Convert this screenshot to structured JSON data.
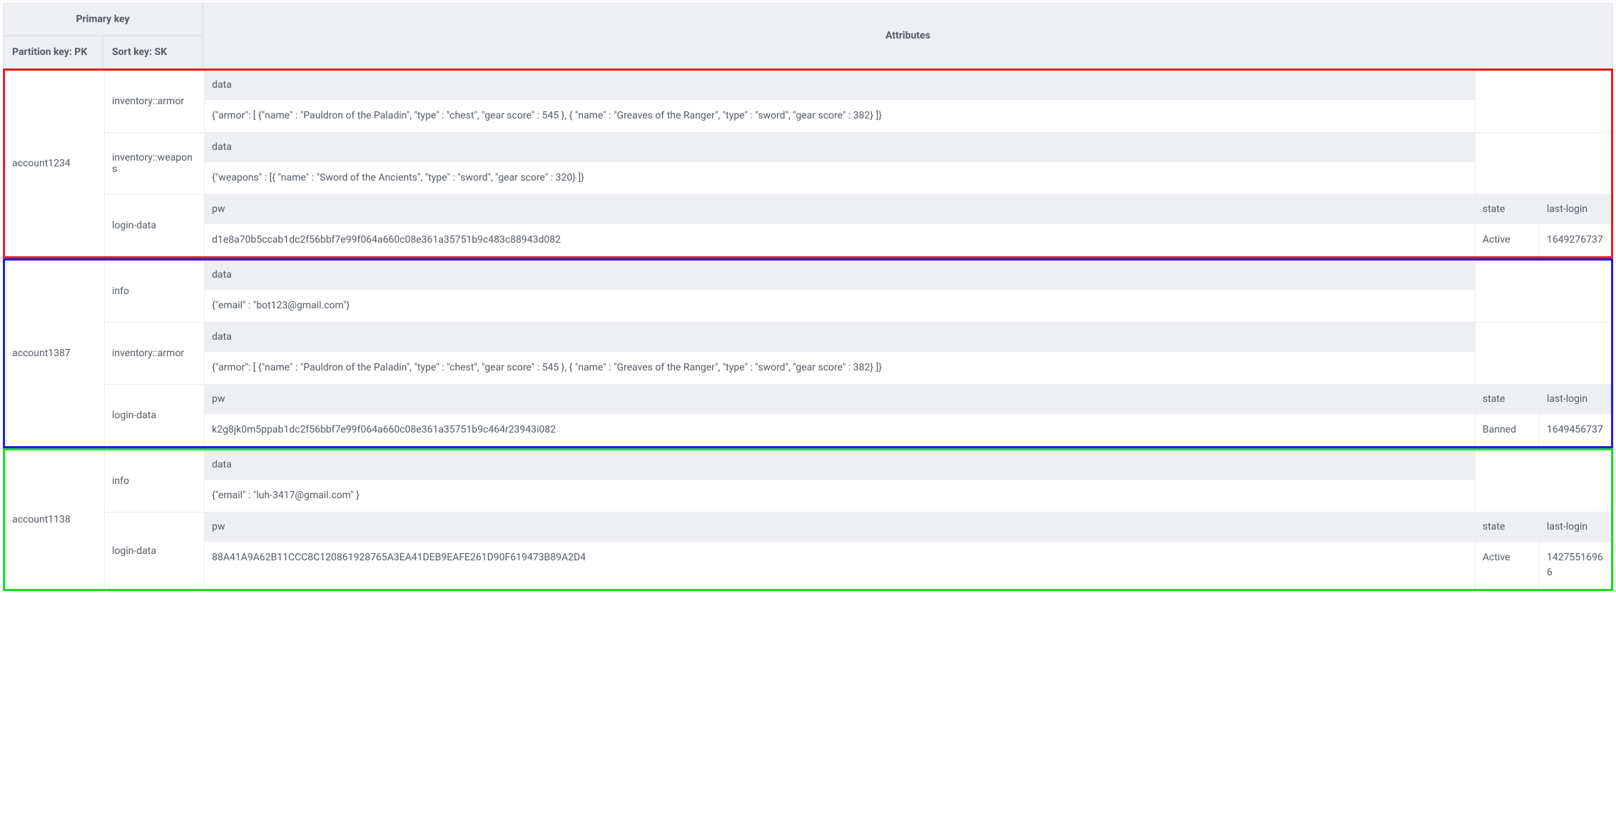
{
  "header": {
    "primary_key": "Primary key",
    "partition_key": "Partition key: PK",
    "sort_key": "Sort key: SK",
    "attributes": "Attributes"
  },
  "attr_labels": {
    "data": "data",
    "pw": "pw",
    "state": "state",
    "last_login": "last-login"
  },
  "groups": [
    {
      "color": "red",
      "pk": "account1234",
      "rows": [
        {
          "sk": "inventory::armor",
          "cols": [
            {
              "type": "main",
              "header": "data",
              "value": "{\"armor\": [ {\"name\" : \"Pauldron of the Paladin\", \"type\" : \"chest\", \"gear score\" : 545 }, { \"name\" : \"Greaves of the Ranger\", \"type\" : \"sword\", \"gear score\" : 382} ]}"
            }
          ],
          "empty_right": true
        },
        {
          "sk": "inventory::weapons",
          "cols": [
            {
              "type": "main",
              "header": "data",
              "value": "{\"weapons\" : [{ \"name\" : \"Sword of the Ancients\", \"type\" : \"sword\", \"gear score\" : 320} ]}"
            }
          ],
          "empty_right": true
        },
        {
          "sk": "login-data",
          "cols": [
            {
              "type": "main",
              "header": "pw",
              "value": "d1e8a70b5ccab1dc2f56bbf7e99f064a660c08e361a35751b9c483c88943d082"
            },
            {
              "type": "state",
              "header": "state",
              "value": "Active"
            },
            {
              "type": "login",
              "header": "last-login",
              "value": "1649276737"
            }
          ],
          "empty_right": false
        }
      ]
    },
    {
      "color": "blue",
      "pk": "account1387",
      "rows": [
        {
          "sk": "info",
          "cols": [
            {
              "type": "main",
              "header": "data",
              "value": "{\"email\" : \"bot123@gmail.com\"}"
            }
          ],
          "empty_right": true
        },
        {
          "sk": "inventory::armor",
          "cols": [
            {
              "type": "main",
              "header": "data",
              "value": "{\"armor\": [ {\"name\" : \"Pauldron of the Paladin\", \"type\" : \"chest\", \"gear score\" : 545 }, { \"name\" : \"Greaves of the Ranger\", \"type\" : \"sword\", \"gear score\" : 382} ]}"
            }
          ],
          "empty_right": true
        },
        {
          "sk": "login-data",
          "cols": [
            {
              "type": "main",
              "header": "pw",
              "value": "k2g8jk0m5ppab1dc2f56bbf7e99f064a660c08e361a35751b9c464r23943i082"
            },
            {
              "type": "state",
              "header": "state",
              "value": "Banned"
            },
            {
              "type": "login",
              "header": "last-login",
              "value": "1649456737"
            }
          ],
          "empty_right": false
        }
      ]
    },
    {
      "color": "green",
      "pk": "account1138",
      "rows": [
        {
          "sk": "info",
          "cols": [
            {
              "type": "main",
              "header": "data",
              "value": "{\"email\" : \"luh-3417@gmail.com\" }"
            }
          ],
          "empty_right": true
        },
        {
          "sk": "login-data",
          "cols": [
            {
              "type": "main",
              "header": "pw",
              "value": "88A41A9A62B11CCC8C120861928765A3EA41DEB9EAFE261D90F619473B89A2D4"
            },
            {
              "type": "state",
              "header": "state",
              "value": "Active"
            },
            {
              "type": "login",
              "header": "last-login",
              "value": "14275516966"
            }
          ],
          "empty_right": false
        }
      ]
    }
  ]
}
